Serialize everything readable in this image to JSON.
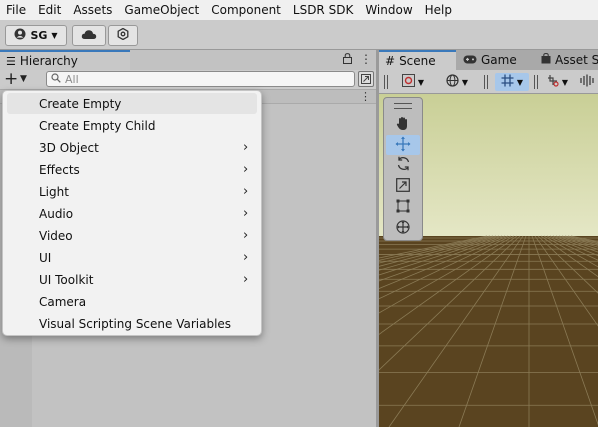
{
  "menubar": {
    "items": [
      "File",
      "Edit",
      "Assets",
      "GameObject",
      "Component",
      "LSDR SDK",
      "Window",
      "Help"
    ]
  },
  "toolbar": {
    "account_label": "SG",
    "account_icon": "user-circle-icon",
    "cloud_icon": "cloud-icon",
    "settings_icon": "gear-icon"
  },
  "hierarchy": {
    "tab_label": "Hierarchy",
    "search_placeholder": "All",
    "add_button": "+"
  },
  "scene": {
    "tabs": [
      {
        "label": "Scene",
        "icon": "hash-icon"
      },
      {
        "label": "Game",
        "icon": "gamepad-icon"
      },
      {
        "label": "Asset S",
        "icon": "shopping-bag-icon"
      }
    ]
  },
  "palette": {
    "tools": [
      "hand-tool",
      "move-tool",
      "rotate-tool",
      "scale-tool",
      "rect-tool",
      "transform-tool"
    ],
    "active": "move-tool"
  },
  "dropdown": {
    "items": [
      {
        "label": "Create Empty",
        "submenu": false,
        "highlighted": true
      },
      {
        "label": "Create Empty Child",
        "submenu": false
      },
      {
        "label": "3D Object",
        "submenu": true
      },
      {
        "label": "Effects",
        "submenu": true
      },
      {
        "label": "Light",
        "submenu": true
      },
      {
        "label": "Audio",
        "submenu": true
      },
      {
        "label": "Video",
        "submenu": true
      },
      {
        "label": "UI",
        "submenu": true
      },
      {
        "label": "UI Toolkit",
        "submenu": true
      },
      {
        "label": "Camera",
        "submenu": false
      },
      {
        "label": "Visual Scripting Scene Variables",
        "submenu": false
      }
    ]
  },
  "colors": {
    "accent": "#3a79bb",
    "sky_top": "#c9cf96",
    "sky_bottom": "#e6e8c8",
    "ground": "#5a4420",
    "grid": "#8a7a55",
    "active_tool": "#a7c7ea"
  }
}
